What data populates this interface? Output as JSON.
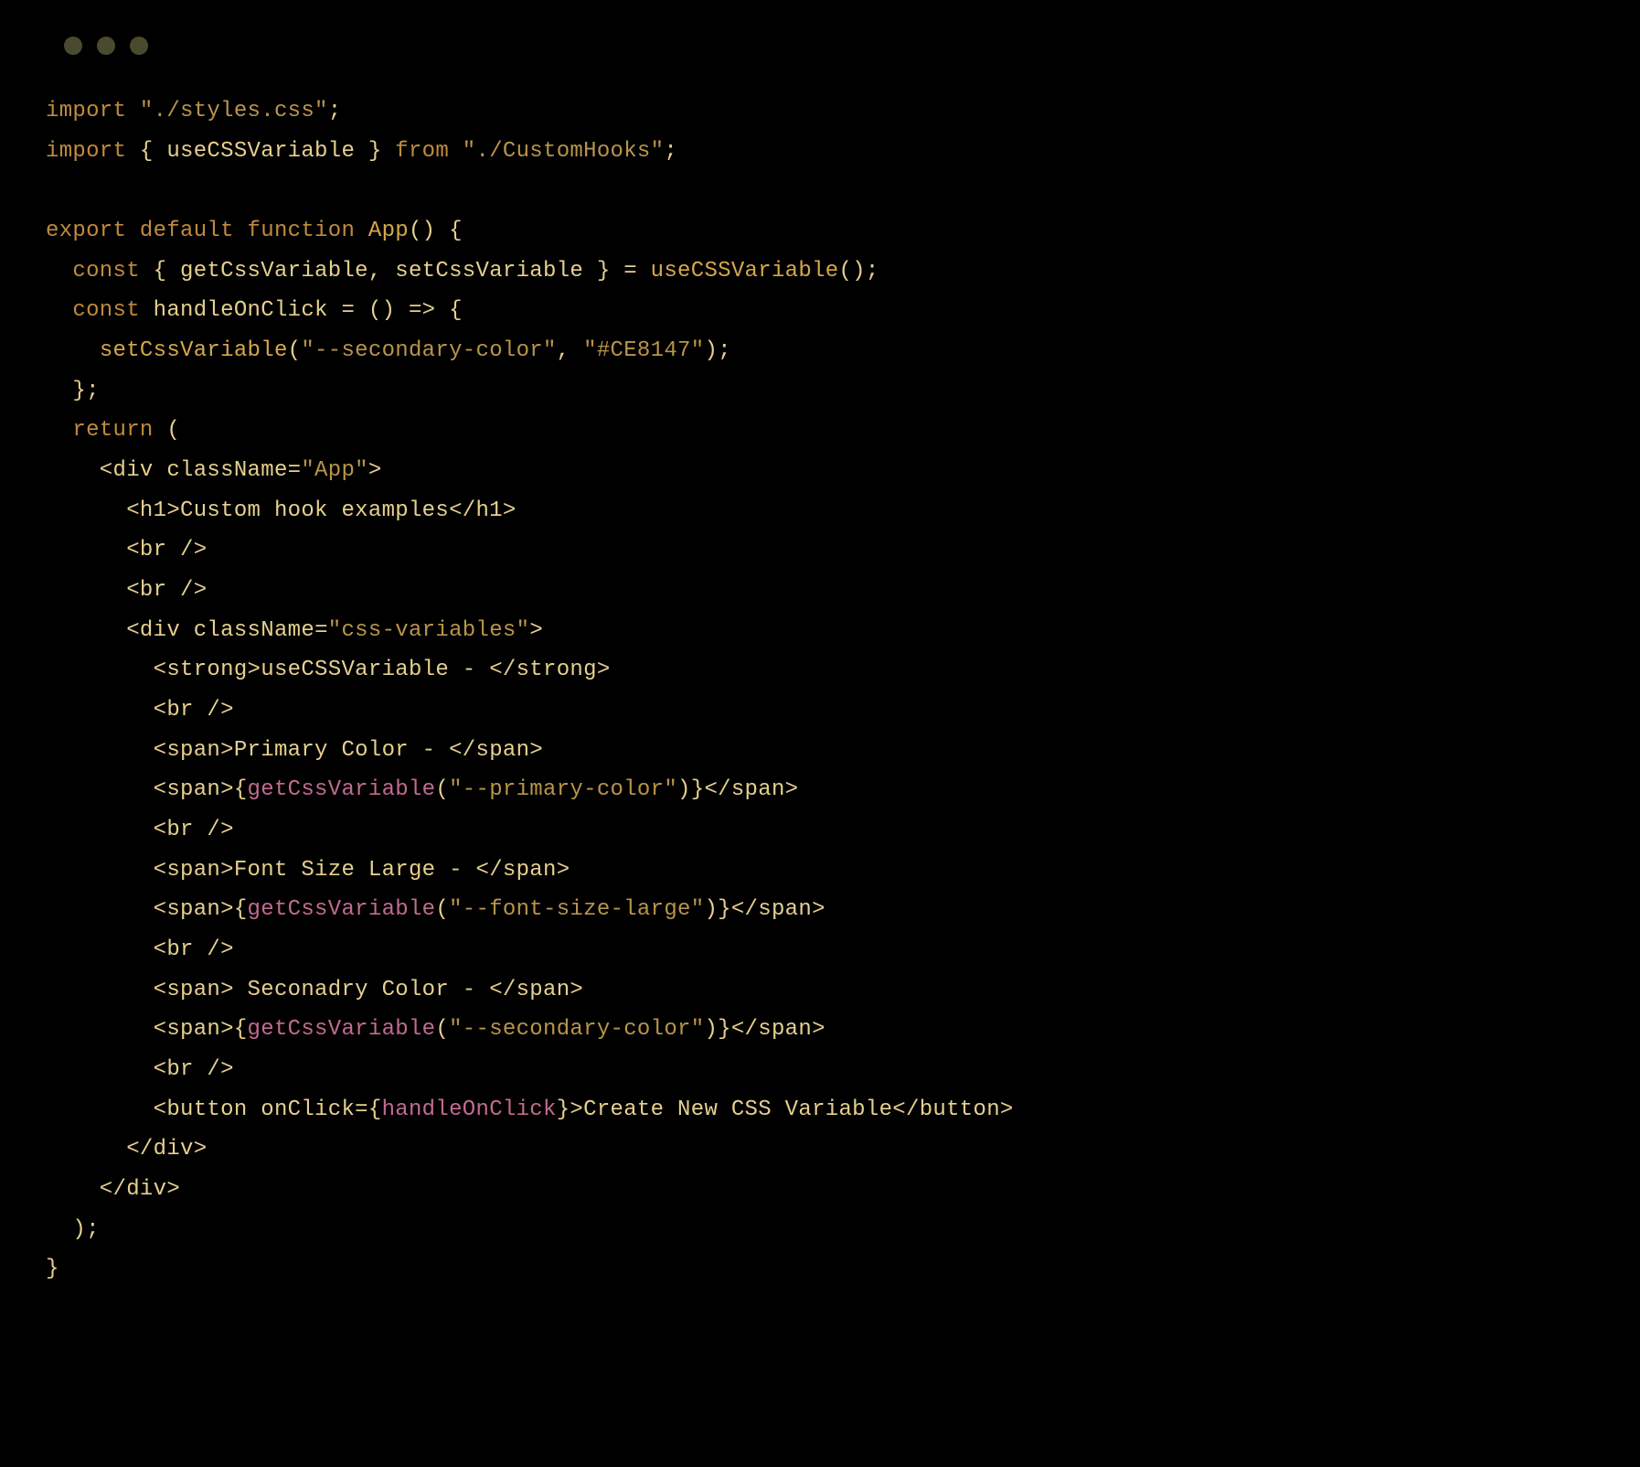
{
  "code": {
    "l1": {
      "kw1": "import",
      "s1": " ",
      "str1": "\"./styles.css\"",
      "s2": ";"
    },
    "l2": {
      "kw1": "import",
      "s1": " { ",
      "id1": "useCSSVariable",
      "s2": " } ",
      "kw2": "from",
      "s3": " ",
      "str1": "\"./CustomHooks\"",
      "s4": ";"
    },
    "l4": {
      "kw1": "export",
      "s1": " ",
      "kw2": "default",
      "s2": " ",
      "kw3": "function",
      "s3": " ",
      "fn": "App",
      "s4": "() {"
    },
    "l5": {
      "s0": "  ",
      "kw1": "const",
      "s1": " { ",
      "id1": "getCssVariable",
      "s2": ", ",
      "id2": "setCssVariable",
      "s3": " } = ",
      "fn": "useCSSVariable",
      "s4": "();"
    },
    "l6": {
      "s0": "  ",
      "kw1": "const",
      "s1": " ",
      "id1": "handleOnClick",
      "s2": " = () => {"
    },
    "l7": {
      "s0": "    ",
      "fn": "setCssVariable",
      "s1": "(",
      "str1": "\"--secondary-color\"",
      "s2": ", ",
      "str2": "\"#CE8147\"",
      "s3": ");"
    },
    "l8": {
      "s0": "  };"
    },
    "l9": {
      "s0": "  ",
      "kw1": "return",
      "s1": " ("
    },
    "l10": {
      "s0": "    <",
      "tag": "div",
      "s1": " ",
      "attr": "className",
      "s2": "=",
      "str": "\"App\"",
      "s3": ">"
    },
    "l11": {
      "s0": "      <",
      "tag1": "h1",
      "s1": ">",
      "txt": "Custom hook examples",
      "s2": "</",
      "tag2": "h1",
      "s3": ">"
    },
    "l12": {
      "s0": "      <",
      "tag": "br",
      "s1": " />"
    },
    "l13": {
      "s0": "      <",
      "tag": "br",
      "s1": " />"
    },
    "l14": {
      "s0": "      <",
      "tag": "div",
      "s1": " ",
      "attr": "className",
      "s2": "=",
      "str": "\"css-variables\"",
      "s3": ">"
    },
    "l15": {
      "s0": "        <",
      "tag1": "strong",
      "s1": ">",
      "txt": "useCSSVariable - ",
      "s2": "</",
      "tag2": "strong",
      "s3": ">"
    },
    "l16": {
      "s0": "        <",
      "tag": "br",
      "s1": " />"
    },
    "l17": {
      "s0": "        <",
      "tag1": "span",
      "s1": ">",
      "txt": "Primary Color - ",
      "s2": "</",
      "tag2": "span",
      "s3": ">"
    },
    "l18": {
      "s0": "        <",
      "tag1": "span",
      "s1": ">{",
      "fn": "getCssVariable",
      "s2": "(",
      "str": "\"--primary-color\"",
      "s3": ")}</",
      "tag2": "span",
      "s4": ">"
    },
    "l19": {
      "s0": "        <",
      "tag": "br",
      "s1": " />"
    },
    "l20": {
      "s0": "        <",
      "tag1": "span",
      "s1": ">",
      "txt": "Font Size Large - ",
      "s2": "</",
      "tag2": "span",
      "s3": ">"
    },
    "l21": {
      "s0": "        <",
      "tag1": "span",
      "s1": ">{",
      "fn": "getCssVariable",
      "s2": "(",
      "str": "\"--font-size-large\"",
      "s3": ")}</",
      "tag2": "span",
      "s4": ">"
    },
    "l22": {
      "s0": "        <",
      "tag": "br",
      "s1": " />"
    },
    "l23": {
      "s0": "        <",
      "tag1": "span",
      "s1": ">",
      "txt": " Seconadry Color - ",
      "s2": "</",
      "tag2": "span",
      "s3": ">"
    },
    "l24": {
      "s0": "        <",
      "tag1": "span",
      "s1": ">{",
      "fn": "getCssVariable",
      "s2": "(",
      "str": "\"--secondary-color\"",
      "s3": ")}</",
      "tag2": "span",
      "s4": ">"
    },
    "l25": {
      "s0": "        <",
      "tag": "br",
      "s1": " />"
    },
    "l26": {
      "s0": "        <",
      "tag1": "button",
      "s1": " ",
      "attr": "onClick",
      "s2": "={",
      "pink": "handleOnClick",
      "s3": "}>",
      "txt": "Create New CSS Variable",
      "s4": "</",
      "tag2": "button",
      "s5": ">"
    },
    "l27": {
      "s0": "      </",
      "tag": "div",
      "s1": ">"
    },
    "l28": {
      "s0": "    </",
      "tag": "div",
      "s1": ">"
    },
    "l29": {
      "s0": "  );"
    },
    "l30": {
      "s0": "}"
    }
  }
}
